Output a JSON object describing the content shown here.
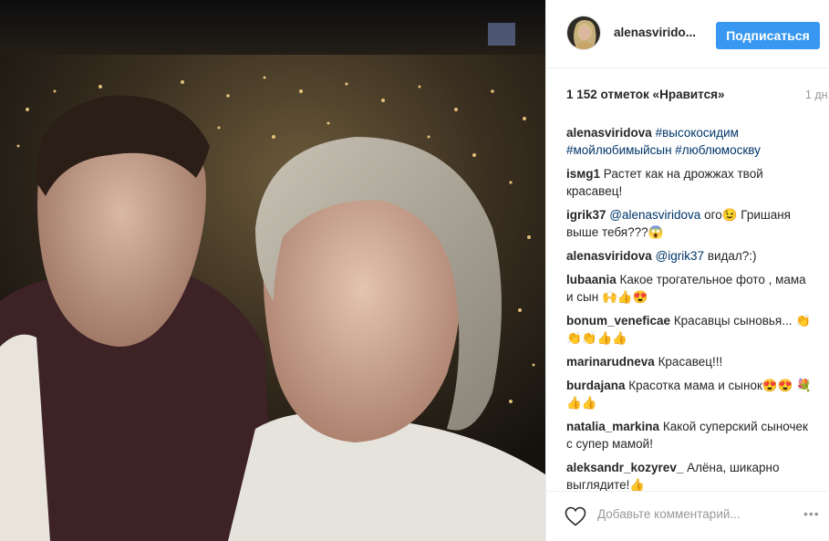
{
  "post": {
    "photo_alt": "night city selfie",
    "username": "alenasviridova",
    "username_display": "alenasvirido...",
    "follow_label": "Подписаться",
    "likes": "1 152 отметок «Нравится»",
    "age": "1 дн."
  },
  "comments": [
    {
      "user": "alenasviridova",
      "parts": [
        {
          "t": "#высокосидим #мойлюбимыйсын #люблюмоскву",
          "link": true
        }
      ]
    },
    {
      "user": "isмg1",
      "parts": [
        {
          "t": "Растет как на дрожжах твой красавец!",
          "link": false
        }
      ]
    },
    {
      "user": "igrik37",
      "parts": [
        {
          "t": "@alenasviridova",
          "link": true
        },
        {
          "t": " ого😉 Гришаня выше тебя???😱",
          "link": false
        }
      ]
    },
    {
      "user": "alenasviridova",
      "parts": [
        {
          "t": "@igrik37",
          "link": true
        },
        {
          "t": " видал?:)",
          "link": false
        }
      ]
    },
    {
      "user": "lubaania",
      "parts": [
        {
          "t": "Какое трогательное фото , мама и сын 🙌👍😍",
          "link": false
        }
      ]
    },
    {
      "user": "bonum_veneficae",
      "parts": [
        {
          "t": "Красавцы сыновья... 👏👏👏👍👍",
          "link": false
        }
      ]
    },
    {
      "user": "marinarudneva",
      "parts": [
        {
          "t": "Красавец!!!",
          "link": false
        }
      ]
    },
    {
      "user": "burdajana",
      "parts": [
        {
          "t": "Красотка мама и сынок😍😍 💐👍👍",
          "link": false
        }
      ]
    },
    {
      "user": "natalia_markina",
      "parts": [
        {
          "t": "Какой суперский сыночек с супер мамой!",
          "link": false
        }
      ]
    },
    {
      "user": "aleksandr_kozyrev_",
      "parts": [
        {
          "t": "Алёна, шикарно выглядите!👍",
          "link": false
        }
      ]
    }
  ],
  "footer": {
    "add_comment_placeholder": "Добавьте комментарий...",
    "more_label": "•••"
  },
  "icons": {
    "like": "heart-icon",
    "more": "more-options-icon"
  },
  "colors": {
    "accent": "#3897f0",
    "link": "#003569",
    "muted": "#999999"
  }
}
